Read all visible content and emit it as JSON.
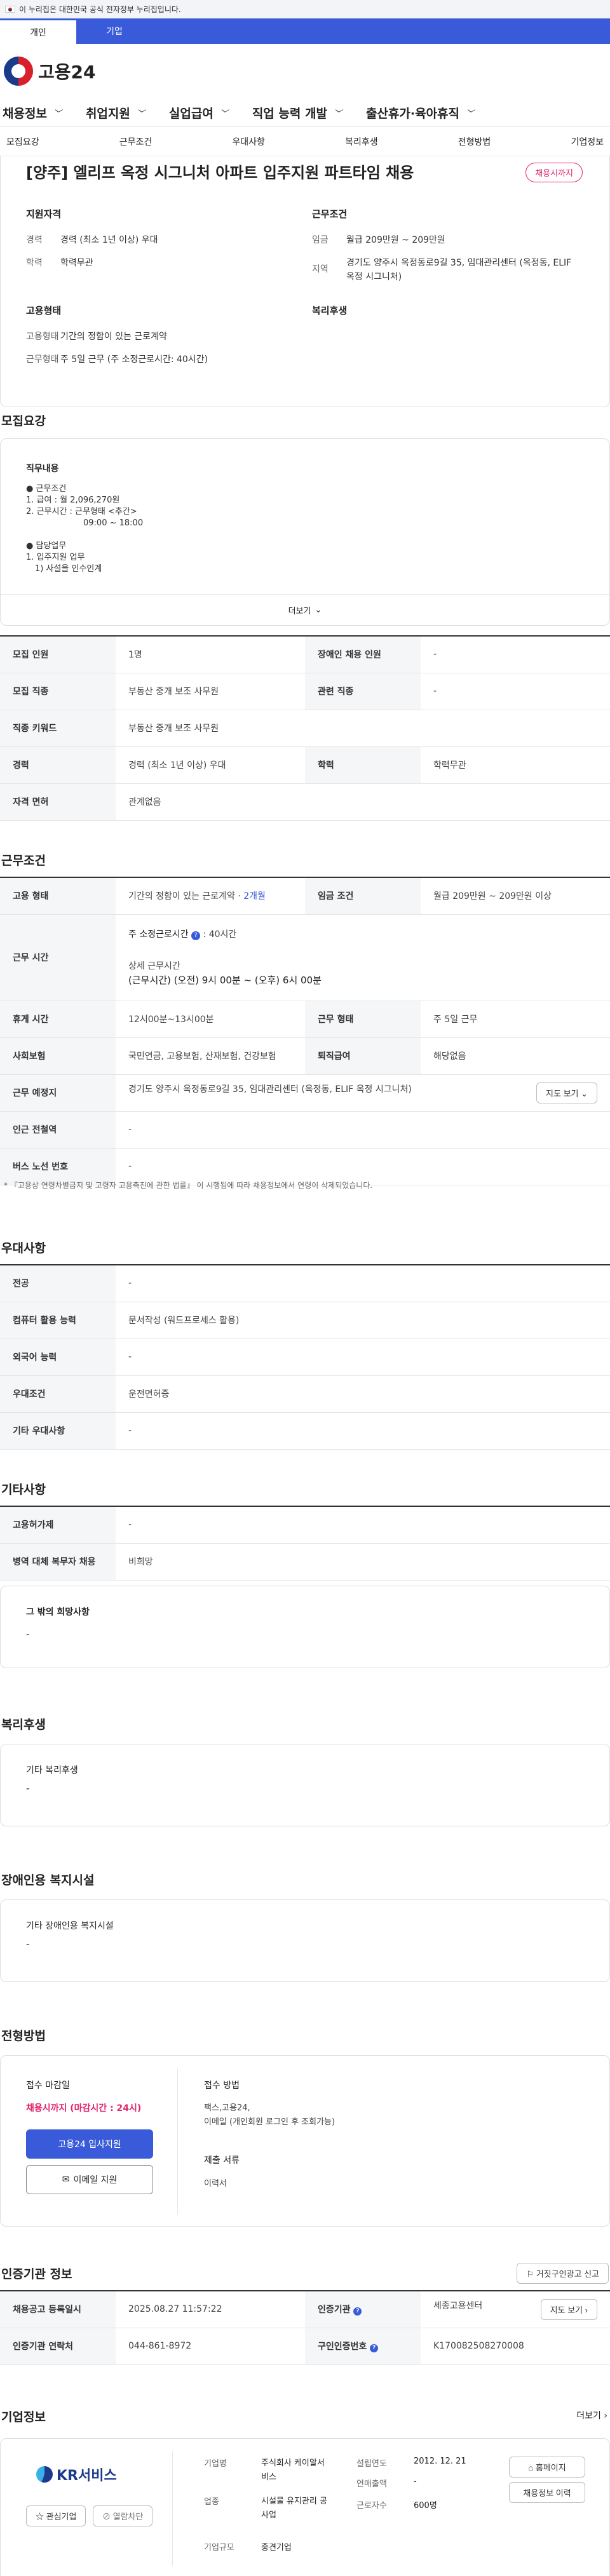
{
  "banner": {
    "text": "이 누리집은 대한민국 공식 전자정부 누리집입니다."
  },
  "usertabs": [
    "개인",
    "기업"
  ],
  "logo": "고용24",
  "gnb": [
    "채용정보",
    "취업지원",
    "실업급여",
    "직업 능력 개발",
    "출산휴가·육아휴직"
  ],
  "subnav": [
    "모집요강",
    "근무조건",
    "우대사항",
    "복리후생",
    "전형방법",
    "기업정보"
  ],
  "job": {
    "title": "[양주] 엘리프 옥정 시그니처 아파트 입주지원 파트타임 채용",
    "badge": "채용시까지",
    "qual_title": "지원자격",
    "career_k": "경력",
    "career_v": "경력 (최소 1년 이상) 우대",
    "edu_k": "학력",
    "edu_v": "학력무관",
    "cond_title": "근무조건",
    "wage_k": "임금",
    "wage_v": "월급 209만원 ~ 209만원",
    "loc_k": "지역",
    "loc_v": "경기도 양주시 옥정동로9길 35, 임대관리센터 (옥정동, ELIF 옥정 시그니처)",
    "emp_title": "고용형태",
    "type_k": "고용형태",
    "type_v": "기간의 정함이 있는 근로계약",
    "form_k": "근무형태",
    "form_v": "주 5일 근무 (주 소정근로시간: 40시간)",
    "welfare_title": "복리후생"
  },
  "recruit": {
    "title": "모집요강",
    "duty_title": "직무내용",
    "lines": [
      "● 근무조건",
      "1. 급여 : 월 2,096,270원",
      "2. 근무시간 : 근무형태 <추간>",
      "09:00 ~ 18:00",
      "",
      "● 담당업무",
      "1. 입주지원 업무",
      "1) 사설을 인수인계"
    ],
    "more": "더보기"
  },
  "recruit_table": {
    "count_k": "모집 인원",
    "count_v": "1명",
    "dis_k": "장애인 채용 인원",
    "dis_v": "-",
    "job_k": "모집 직종",
    "job_v": "부동산 중개 보조 사무원",
    "rel_k": "관련 직종",
    "rel_v": "-",
    "kw_k": "직종 키워드",
    "kw_v": "부동산 중개 보조 사무원",
    "car_k": "경력",
    "car_v": "경력 (최소 1년 이상) 우대",
    "edu_k": "학력",
    "edu_v": "학력무관",
    "lic_k": "자격 면허",
    "lic_v": "관계없음"
  },
  "work": {
    "title": "근무조건",
    "type_k": "고용 형태",
    "type_v": "기간의 정함이 있는 근로계약 · ",
    "type_v2": "2개월",
    "wage_k": "임금 조건",
    "wage_v": "월급 209만원 ~ 209만원 이상",
    "hours_k": "근무 시간",
    "hours_a": "주 소정근로시간",
    "hours_b": ": 40시간",
    "hours_c": "상세 근무시간",
    "hours_d": "(근무시간) (오전) 9시 00분 ~ (오후) 6시 00분",
    "rest_k": "휴게 시간",
    "rest_v": "12시00분~13시00분",
    "form_k": "근무 형태",
    "form_v": "주 5일 근무",
    "ins_k": "사회보험",
    "ins_v": "국민연금, 고용보험, 산재보험, 건강보험",
    "ret_k": "퇴직급여",
    "ret_v": "해당없음",
    "place_k": "근무 예정지",
    "place_v": "경기도 양주시 옥정동로9길 35, 임대관리센터 (옥정동, ELIF 옥정 시그니처)",
    "map": "지도 보기",
    "sub_k": "인근 전철역",
    "sub_v": "-",
    "bus_k": "버스 노선 번호",
    "bus_v": "-",
    "note": "* 『고용상 연령차별금지 및 고령자 고용촉진에 관한 법률』 이 시행됨에 따라 채용정보에서 연령이 삭제되었습니다."
  },
  "pref": {
    "title": "우대사항",
    "major_k": "전공",
    "major_v": "-",
    "pc_k": "컴퓨터 활용 능력",
    "pc_v": "문서작성 (워드프로세스 활용)",
    "lang_k": "외국어 능력",
    "lang_v": "-",
    "cond_k": "우대조건",
    "cond_v": "운전면허증",
    "etc_k": "기타 우대사항",
    "etc_v": "-"
  },
  "other": {
    "title": "기타사항",
    "emp_k": "고용허가제",
    "emp_v": "-",
    "mil_k": "병역 대체 복무자 채용",
    "mil_v": "비희망",
    "wish_t": "그 밖의 희망사항",
    "wish_v": "-"
  },
  "welfare": {
    "title": "복리후생",
    "t": "기타 복리후생",
    "v": "-"
  },
  "disab": {
    "title": "장애인용 복지시설",
    "t": "기타 장애인용 복지시설",
    "v": "-"
  },
  "select": {
    "title": "전형방법",
    "deadline_t": "접수 마감일",
    "deadline_v": "채용시까지 (마감시간 : 24시)",
    "apply": "고용24 입사지원",
    "email": "이메일 지원",
    "method_t": "접수 방법",
    "method_v1": "팩스,고용24,",
    "method_v2": "이메일 (개인회원 로그인 후 조회가능)",
    "doc_t": "제출 서류",
    "doc_v": "이력서"
  },
  "cert": {
    "title": "인증기관 정보",
    "report": "거짓구인광고 신고",
    "reg_k": "채용공고 등록일시",
    "reg_v": "2025.08.27 11:57:22",
    "org_k": "인증기관",
    "org_v": "세종고용센터",
    "map": "지도 보기",
    "tel_k": "인증기관 연락처",
    "tel_v": "044-861-8972",
    "no_k": "구인인증번호",
    "no_v": "K170082508270008"
  },
  "company": {
    "title": "기업정보",
    "more": "더보기",
    "logo": "KR서비스",
    "fav": "관심기업",
    "block": "열람차단",
    "name_k": "기업명",
    "name_v": "주식회사 케이알서비스",
    "ind_k": "업종",
    "ind_v": "시설물 유지관리 공사업",
    "scale_k": "기업규모",
    "scale_v": "중견기업",
    "est_k": "설립연도",
    "est_v": "2012. 12. 21",
    "rev_k": "연매출액",
    "rev_v": "-",
    "emp_k": "근로자수",
    "emp_v": "600명",
    "home": "홈페이지",
    "jobs": "채용정보 이력"
  },
  "colors": {
    "primary": "#3a5bd9",
    "accent": "#e2236b"
  }
}
